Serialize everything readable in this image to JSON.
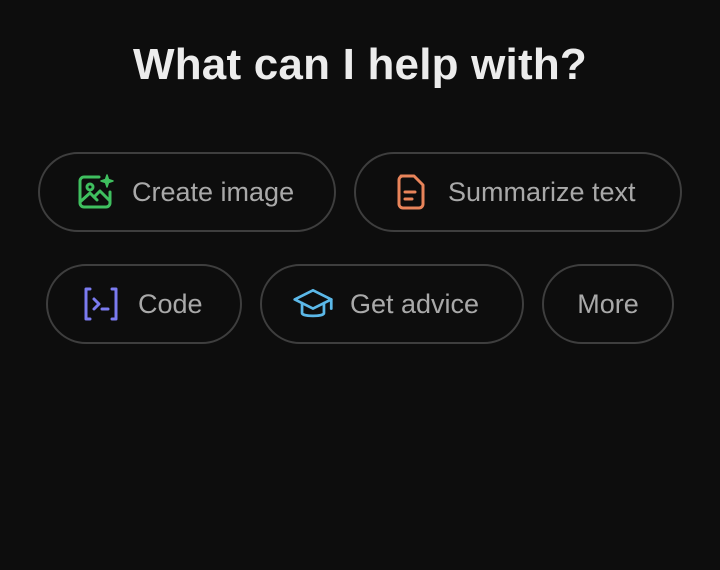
{
  "heading": "What can I help with?",
  "chips": {
    "create_image": {
      "label": "Create image",
      "icon": "image-sparkle-icon",
      "color": "#3fbf5f"
    },
    "summarize_text": {
      "label": "Summarize text",
      "icon": "document-icon",
      "color": "#e8845a"
    },
    "code": {
      "label": "Code",
      "icon": "terminal-code-icon",
      "color": "#7b7bf0"
    },
    "get_advice": {
      "label": "Get advice",
      "icon": "graduation-cap-icon",
      "color": "#5bb8e8"
    },
    "more": {
      "label": "More"
    }
  },
  "colors": {
    "background": "#0d0d0d",
    "chip_border": "#3e3e3e",
    "chip_text": "#a9a9a9",
    "heading_text": "#ececec"
  }
}
